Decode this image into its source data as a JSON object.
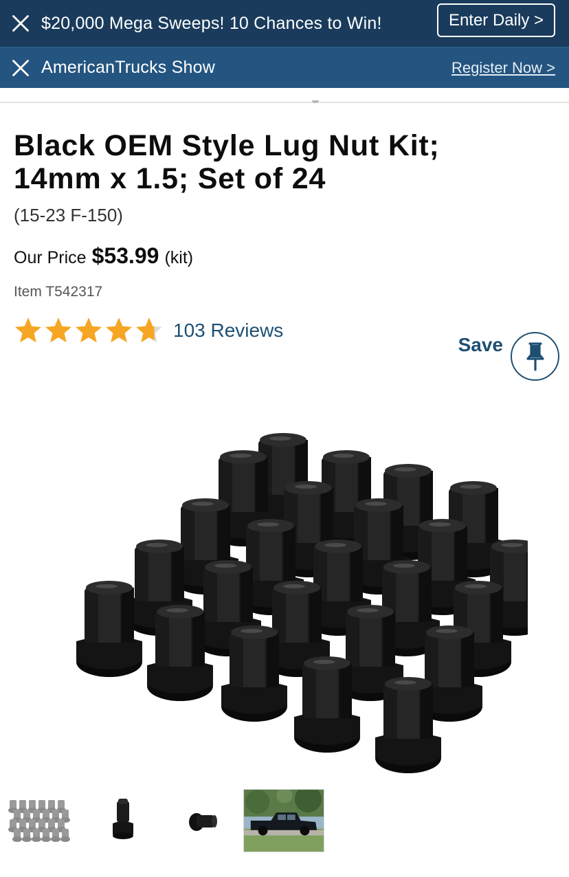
{
  "promo": {
    "message": "$20,000 Mega Sweeps! 10 Chances to Win!",
    "cta_label": "Enter Daily >",
    "close_icon": "close-icon"
  },
  "event": {
    "message": "AmericanTrucks Show",
    "cta_label": "Register Now >",
    "close_icon": "close-icon"
  },
  "product": {
    "title": "Black OEM Style Lug Nut Kit; 14mm x 1.5; Set of 24",
    "fitment": "(15-23 F-150)",
    "price_label": "Our Price",
    "price": "$53.99",
    "price_unit": "(kit)",
    "item_number": "Item T542317",
    "rating": 4.7,
    "rating_max": 5,
    "reviews_label": "103 Reviews",
    "save_label": "Save",
    "save_icon": "pushpin-icon"
  },
  "gallery": {
    "main_image": "black-lug-nuts-set-of-24",
    "thumbnails": [
      "lug-nut-set-grey-thumbnail",
      "single-lug-nut-upright-thumbnail",
      "single-lug-nut-side-thumbnail",
      "truck-photo-thumbnail"
    ]
  },
  "colors": {
    "promo_bg": "#1a3b5c",
    "event_bg": "#245580",
    "link_blue": "#1e4f73",
    "star_gold": "#f6a623"
  }
}
